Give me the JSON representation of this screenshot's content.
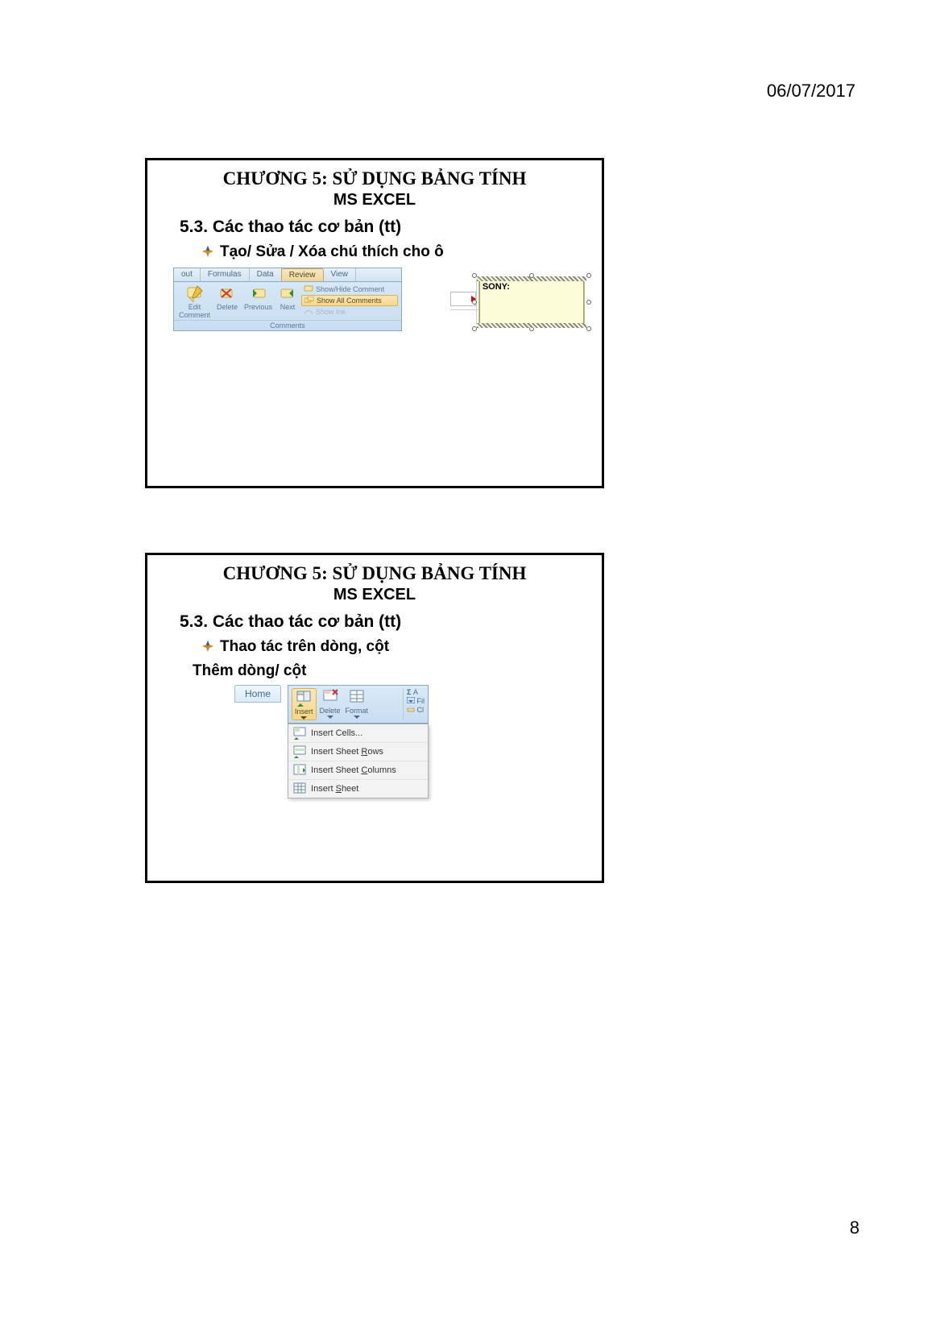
{
  "header": {
    "date": "06/07/2017"
  },
  "footer": {
    "page_number": "8"
  },
  "slide1": {
    "title": "CHƯƠNG 5: SỬ DỤNG BẢNG TÍNH",
    "subtitle": "MS EXCEL",
    "section": "5.3. Các thao tác cơ bản (tt)",
    "bullet": "Tạo/ Sửa / Xóa chú thích cho ô",
    "ribbon": {
      "tabs": {
        "out": "out",
        "formulas": "Formulas",
        "data": "Data",
        "review": "Review",
        "view": "View"
      },
      "buttons": {
        "edit_comment": "Edit\nComment",
        "delete": "Delete",
        "previous": "Previous",
        "next": "Next"
      },
      "options": {
        "show_hide": "Show/Hide Comment",
        "show_all": "Show All Comments",
        "show_ink": "Show Ink"
      },
      "group": "Comments"
    },
    "comment": {
      "author": "SONY:"
    }
  },
  "slide2": {
    "title": "CHƯƠNG 5: SỬ DỤNG BẢNG TÍNH",
    "subtitle": "MS EXCEL",
    "section": "5.3. Các thao tác cơ bản (tt)",
    "bullet": "Thao tác trên dòng, cột",
    "subheading": "Thêm dòng/ cột",
    "ui": {
      "home_tab": "Home",
      "cells": {
        "insert": "Insert",
        "delete": "Delete",
        "format": "Format"
      },
      "right": {
        "autosum_prefix": "Σ A",
        "fill_prefix": "Fil",
        "clear_prefix": "Cl"
      },
      "dropdown": {
        "insert_cells": "Insert Cells...",
        "insert_rows": "Insert Sheet Rows",
        "insert_cols": "Insert Sheet Columns",
        "insert_sheet": "Insert Sheet"
      }
    }
  }
}
